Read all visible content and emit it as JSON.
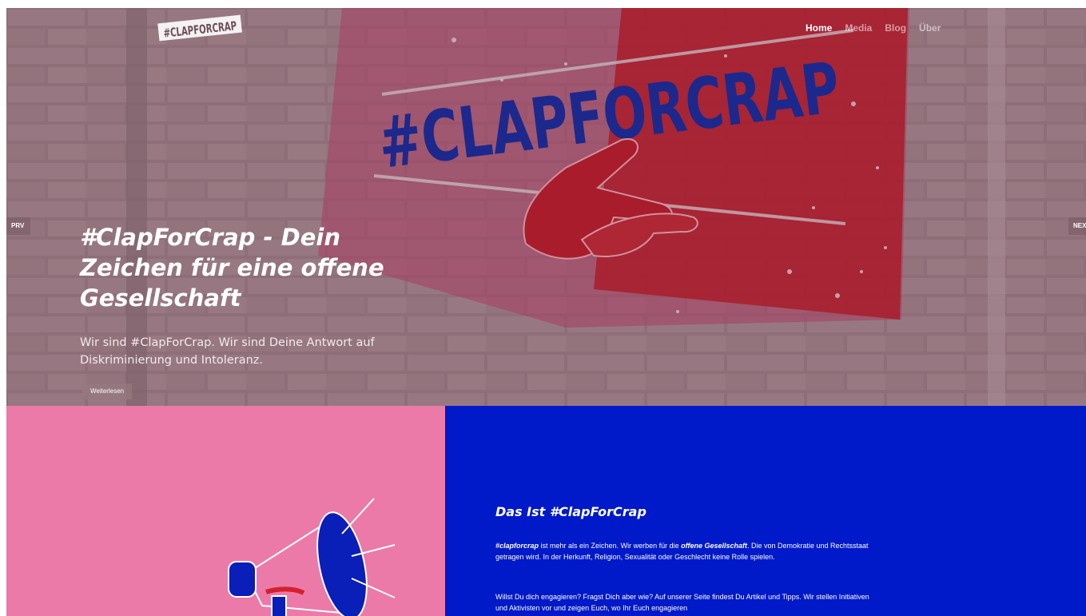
{
  "header": {
    "logo_text": "#CLAPFORCRAP",
    "nav": [
      {
        "label": "Home",
        "active": true
      },
      {
        "label": "Media",
        "active": false
      },
      {
        "label": "Blog",
        "active": false
      },
      {
        "label": "Über",
        "active": false
      }
    ]
  },
  "hero": {
    "artwork_text": "#CLAPFORCRAP",
    "title": "#ClapForCrap - Dein Zeichen für eine offene Gesellschaft",
    "subtitle": "Wir sind #ClapForCrap. Wir sind Deine Antwort auf Diskriminierung und Intoleranz.",
    "button_label": "Weiterlesen",
    "prev_label": "PRV",
    "next_label": "NEXT"
  },
  "about": {
    "title": "Das Ist #ClapForCrap",
    "p1_strong": "#clapforcrap",
    "p1_a": " ist mehr als ein Zeichen. Wir werben für die ",
    "p1_em": "offene Gesellschaft",
    "p1_b": ". Die von Demokratie und Rechtsstaat getragen wird. In der Herkunft, Religion, Sexualität oder Geschlecht keine Rolle spielen.",
    "p2": "Willst Du dich engagieren? Fragst Dich aber wie? Auf unserer Seite findest Du Artikel und Tipps. Wir stellen Initiativen und Aktivisten vor und zeigen Euch, wo Ihr Euch engagieren"
  },
  "colors": {
    "pink": "#ec7aa8",
    "blue": "#0019c9",
    "red": "#b81c2c",
    "brick": "#9b7c86"
  }
}
